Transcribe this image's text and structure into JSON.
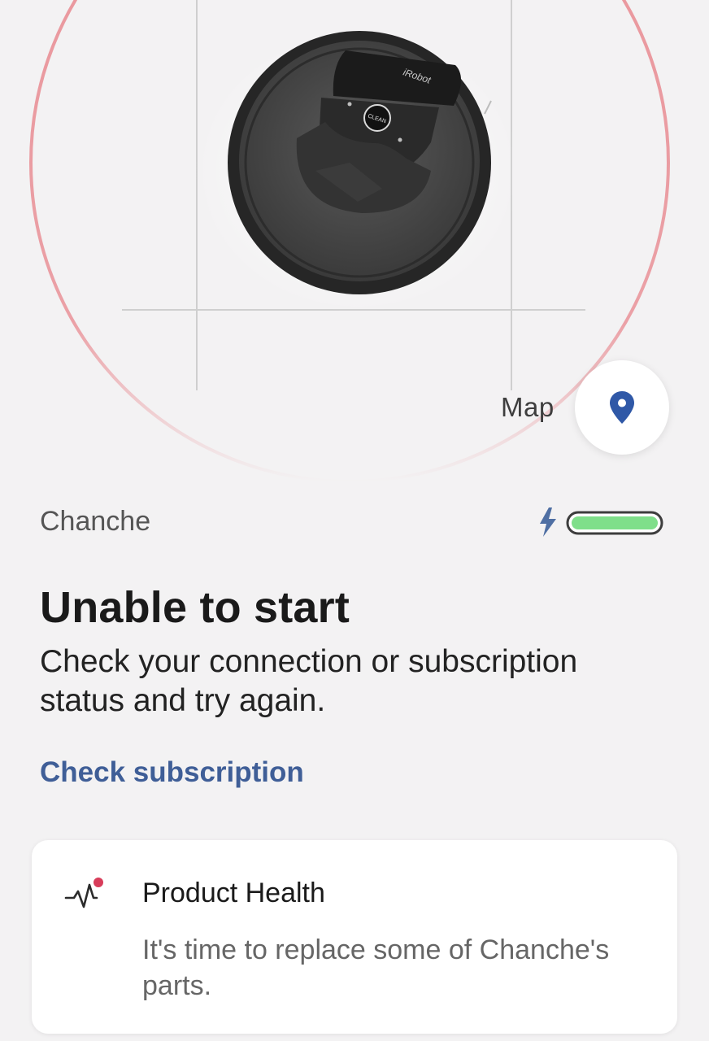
{
  "map": {
    "label": "Map",
    "icon": "map-pin-icon"
  },
  "robot": {
    "name": "Chanche",
    "model_badge": "iRobot",
    "clean_button_label": "CLEAN",
    "battery_level_percent": 100,
    "charging": true,
    "charging_icon": "lightning-icon"
  },
  "status": {
    "title": "Unable to start",
    "message": "Check your connection or subscription status and try again.",
    "link_label": "Check subscription"
  },
  "product_health": {
    "title": "Product Health",
    "message": "It's time to replace some of Chanche's parts.",
    "icon": "pulse-alert-icon"
  },
  "colors": {
    "background": "#f3f2f3",
    "ring": "#e8858c",
    "accent_blue": "#2f58a7",
    "link_blue": "#3f5e97",
    "battery_green": "#7fdf8a",
    "alert_red": "#d83d5a"
  }
}
